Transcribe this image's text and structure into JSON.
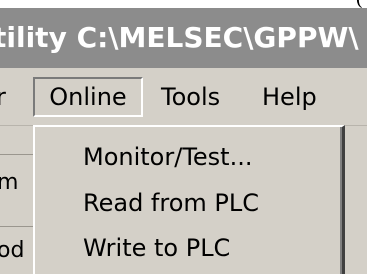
{
  "title_bar": {
    "text": "tility C:\\MELSEC\\GPPW\\"
  },
  "corner_mark": "(",
  "menu_bar": {
    "items": [
      {
        "label": "r"
      },
      {
        "label": "Online",
        "state": "open"
      },
      {
        "label": "Tools"
      },
      {
        "label": "Help"
      }
    ]
  },
  "online_menu": {
    "items": [
      {
        "label": "Monitor/Test..."
      },
      {
        "label": "Read from PLC"
      },
      {
        "label": "Write to PLC"
      }
    ]
  },
  "background_labels": [
    {
      "text": "m"
    },
    {
      "text": "od"
    }
  ],
  "colors": {
    "title_bar": "#8c8c8c",
    "menu_face": "#d4d0c8",
    "text": "#000000"
  }
}
